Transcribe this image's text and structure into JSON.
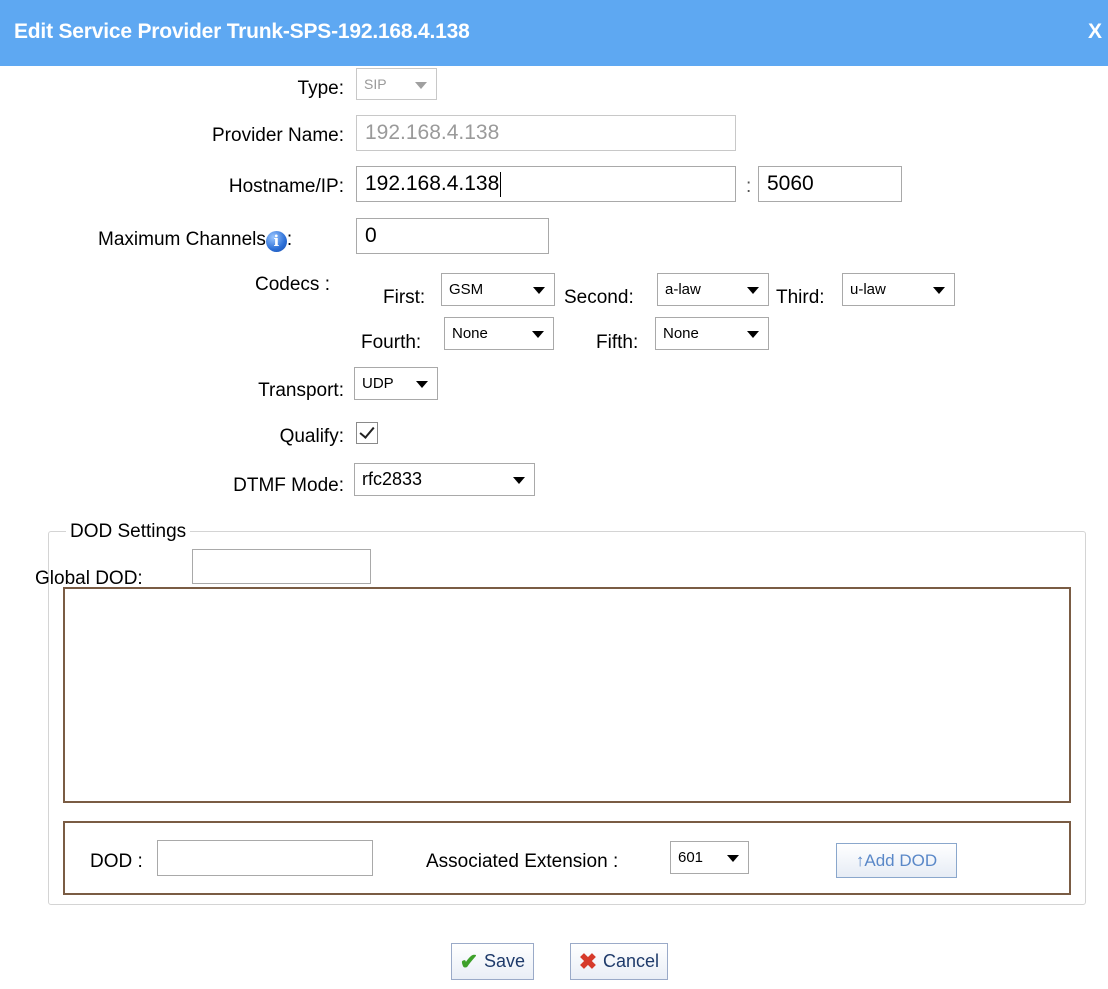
{
  "dialog": {
    "title": "Edit Service Provider Trunk-SPS-192.168.4.138",
    "close": "X"
  },
  "form": {
    "type_label": "Type:",
    "type_value": "SIP",
    "provider_name_label": "Provider Name:",
    "provider_name_value": "192.168.4.138",
    "hostname_label": "Hostname/IP:",
    "hostname_value": "192.168.4.138",
    "port_sep": ":",
    "port_value": "5060",
    "max_channels_label": "Maximum Channels",
    "max_channels_colon": ":",
    "max_channels_value": "0",
    "codecs_label": "Codecs :",
    "codecs": {
      "first_label": "First:",
      "first_value": "GSM",
      "second_label": "Second:",
      "second_value": "a-law",
      "third_label": "Third:",
      "third_value": "u-law",
      "fourth_label": "Fourth:",
      "fourth_value": "None",
      "fifth_label": "Fifth:",
      "fifth_value": "None"
    },
    "transport_label": "Transport:",
    "transport_value": "UDP",
    "qualify_label": "Qualify:",
    "qualify_checked": true,
    "dtmf_label": "DTMF Mode:",
    "dtmf_value": "rfc2833"
  },
  "dod": {
    "legend": "DOD Settings",
    "global_label": "Global DOD:",
    "global_value": "",
    "dod_label": "DOD :",
    "dod_value": "",
    "assoc_label": "Associated Extension :",
    "assoc_value": "601",
    "add_button": "↑Add DOD"
  },
  "actions": {
    "save": "Save",
    "cancel": "Cancel"
  },
  "icons": {
    "info": "info-icon",
    "save": "check-icon",
    "cancel": "x-icon"
  },
  "colors": {
    "titlebar": "#5ea8f2",
    "frame_border": "#7a5c44"
  }
}
